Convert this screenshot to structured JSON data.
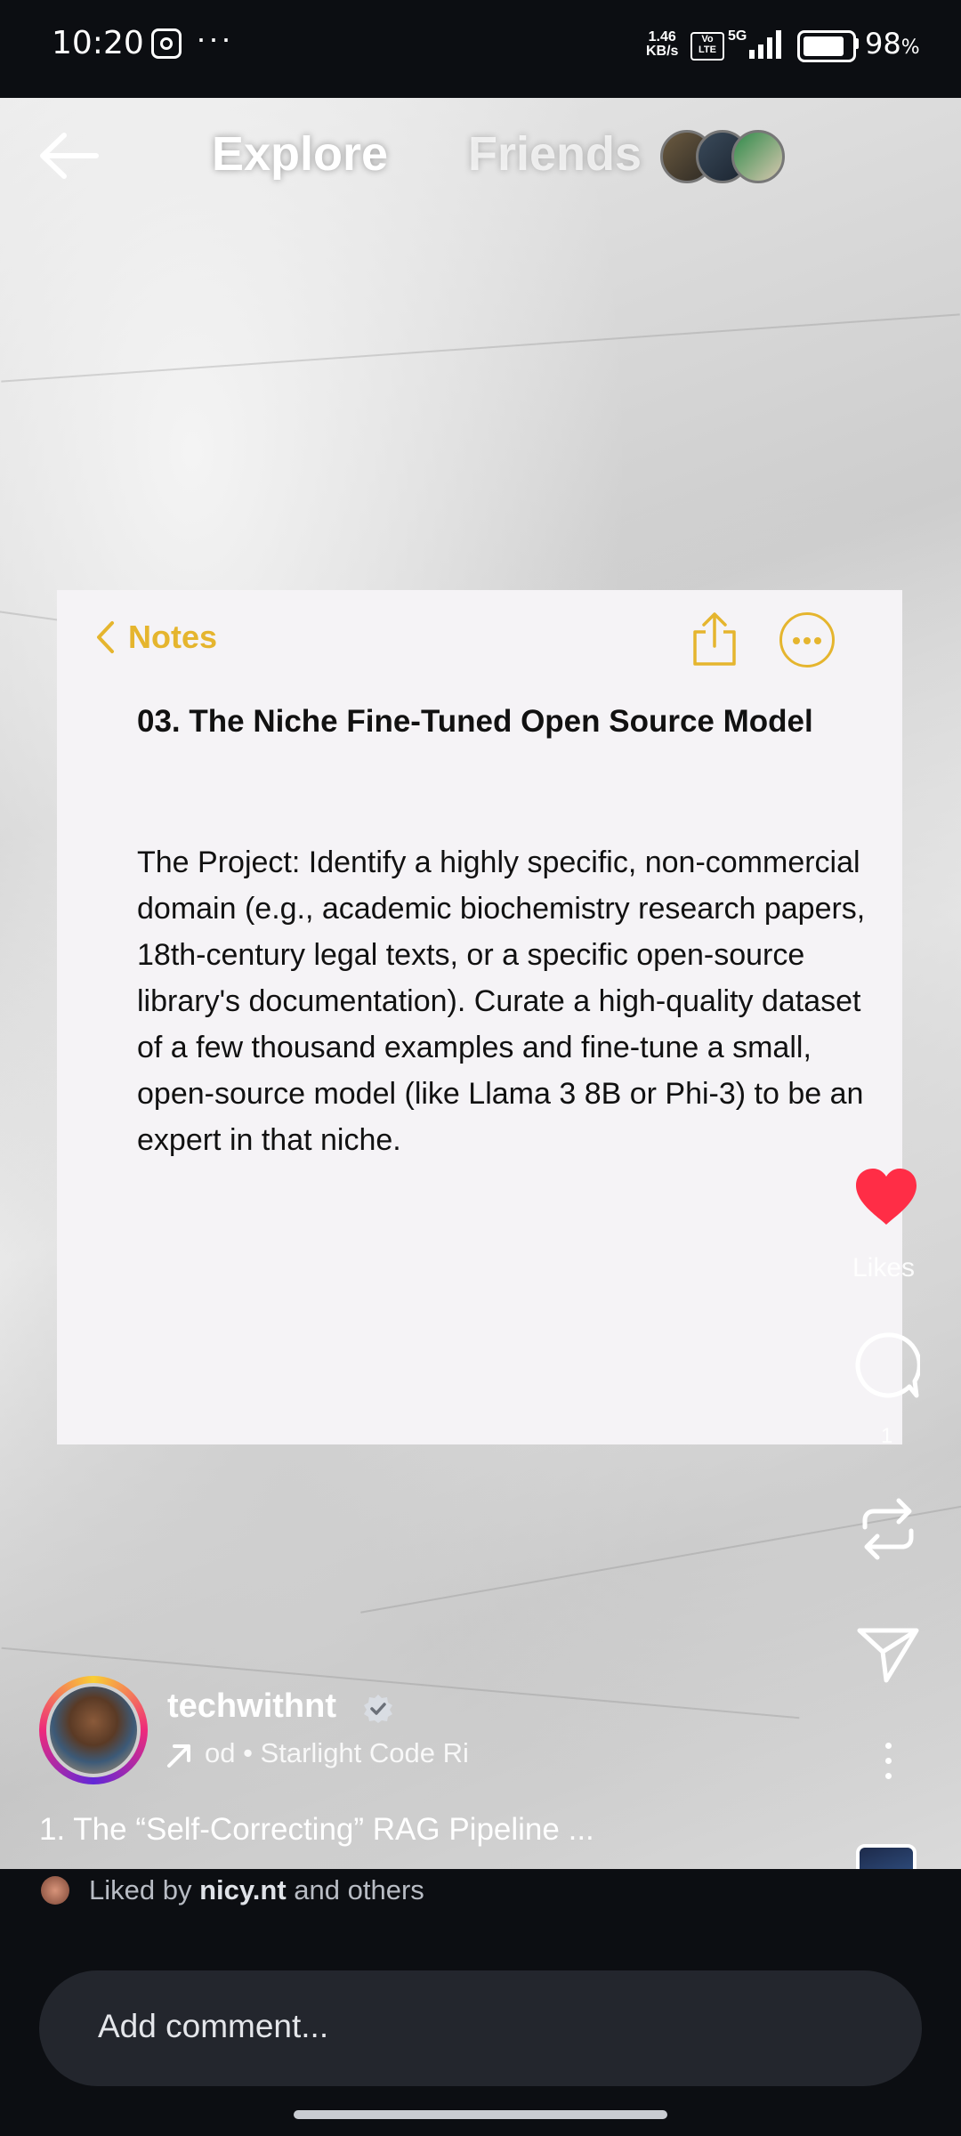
{
  "status_bar": {
    "time": "10:20",
    "overflow": "···",
    "net_speed_value": "1.46",
    "net_speed_unit": "KB/s",
    "volte": "Vo LTE",
    "network": "5G",
    "battery_percent": "98",
    "battery_unit": "%",
    "battery_level": 0.98,
    "icons": [
      "instagram-icon",
      "signal-icon",
      "battery-icon"
    ]
  },
  "top_nav": {
    "back_icon": "arrow-left-icon",
    "tabs": [
      {
        "label": "Explore",
        "active": true
      },
      {
        "label": "Friends",
        "active": false
      }
    ]
  },
  "post": {
    "note": {
      "app_label": "Notes",
      "title": "03. The Niche Fine-Tuned Open Source Model",
      "body": "The Project: Identify a highly specific, non-commercial domain (e.g., academic biochemistry research papers, 18th-century legal texts, or a specific open-source library's documentation). Curate a high-quality dataset of a few thousand examples and fine-tune a small, open-source model (like Llama 3 8B or Phi-3) to be an expert in that niche.",
      "accent_color": "#e5b52e"
    },
    "author": {
      "username": "techwithnt",
      "verified": true,
      "audio": "od • Starlight Code   Ri"
    },
    "caption": "1. The “Self-Correcting” RAG Pipeline ...",
    "liked_by": {
      "prefix": "Liked by ",
      "user": "nicy.nt",
      "suffix": " and others"
    }
  },
  "actions": {
    "likes_label": "Likes",
    "comment_count": "1",
    "heart_color": "#ff2d46"
  },
  "comment_input": {
    "placeholder": "Add comment..."
  }
}
